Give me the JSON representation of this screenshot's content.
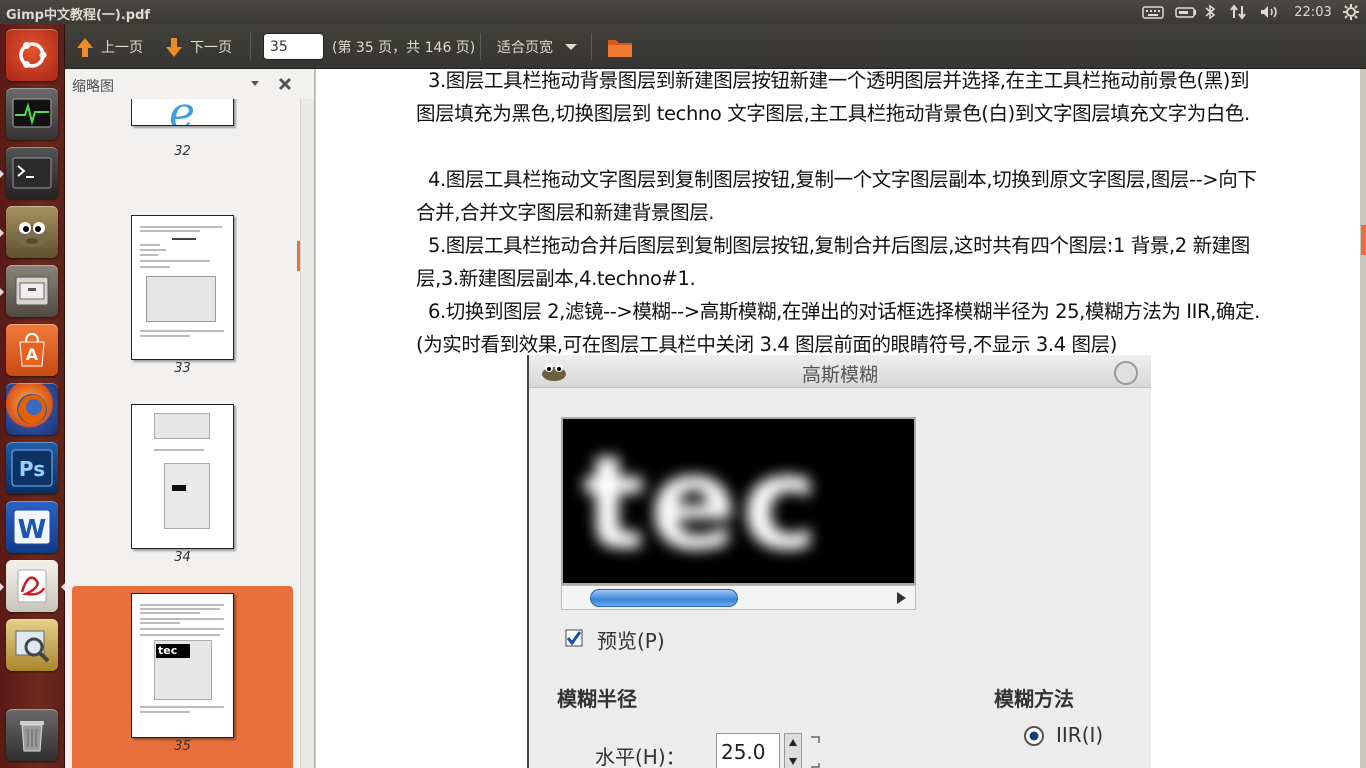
{
  "window_title": "Gimp中文教程(一).pdf",
  "clock": "22:03",
  "toolbar": {
    "prev_label": "上一页",
    "next_label": "下一页",
    "page_value": "35",
    "page_info": "(第 35 页，共 146 页)",
    "zoom_label": "适合页宽"
  },
  "sidebar": {
    "title": "缩略图",
    "thumbnails": [
      {
        "number": "32",
        "selected": false
      },
      {
        "number": "33",
        "selected": false
      },
      {
        "number": "34",
        "selected": false
      },
      {
        "number": "35",
        "selected": true
      }
    ]
  },
  "document": {
    "paragraphs": [
      "3.图层工具栏拖动背景图层到新建图层按钮新建一个透明图层并选择,在主工具栏拖动前景色(黑)到图层填充为黑色,切换图层到 techno 文字图层,主工具栏拖动背景色(白)到文字图层填充文字为白色.",
      "4.图层工具栏拖动文字图层到复制图层按钮,复制一个文字图层副本,切换到原文字图层,图层-->向下合并,合并文字图层和新建背景图层.",
      "5.图层工具栏拖动合并后图层到复制图层按钮,复制合并后图层,这时共有四个图层:1 背景,2 新建图层,3.新建图层副本,4.techno#1.",
      "6.切换到图层 2,滤镜-->模糊-->高斯模糊,在弹出的对话框选择模糊半径为 25,模糊方法为 IIR,确定.(为实时看到效果,可在图层工具栏中关闭 3.4 图层前面的眼睛符号,不显示 3.4 图层)"
    ],
    "dialog": {
      "title": "高斯模糊",
      "preview_text": "tec",
      "preview_label": "预览(P)",
      "radius_label": "模糊半径",
      "method_label": "模糊方法",
      "horizontal_label": "水平(H)：",
      "horizontal_value": "25.0",
      "iir_label": "IIR(I)"
    }
  },
  "colors": {
    "accent": "#e9703c",
    "launcher": "#6d2a1e",
    "panel": "#3c3b37"
  }
}
